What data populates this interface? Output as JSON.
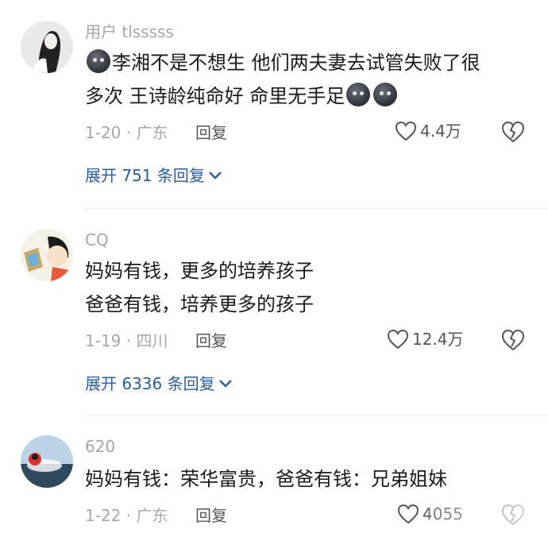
{
  "comments": [
    {
      "username": "用户 tlsssss",
      "text_line1_a": "李湘不是不想生 他们两夫妻去试管失败了很",
      "text_line2_a": "多次 王诗龄纯命好 命里无手足",
      "date_location": "1-20 · 广东",
      "reply_label": "回复",
      "likes": "4.4万",
      "expand_label": "展开 751 条回复",
      "emoji_icon": "dark-blob-emoji-icon"
    },
    {
      "username": "CQ",
      "text_line1": "妈妈有钱，更多的培养孩子",
      "text_line2": "爸爸有钱，培养更多的孩子",
      "date_location": "1-19 · 四川",
      "reply_label": "回复",
      "likes": "12.4万",
      "expand_label": "展开 6336 条回复"
    },
    {
      "username": "620",
      "text_line1": "妈妈有钱：荣华富贵，爸爸有钱：兄弟姐妹",
      "date_location": "1-22 · 广东",
      "reply_label": "回复",
      "likes": "4055"
    }
  ],
  "colors": {
    "username": "#a6a6a6",
    "link": "#2a5d9f",
    "text": "#1a1a1a"
  }
}
